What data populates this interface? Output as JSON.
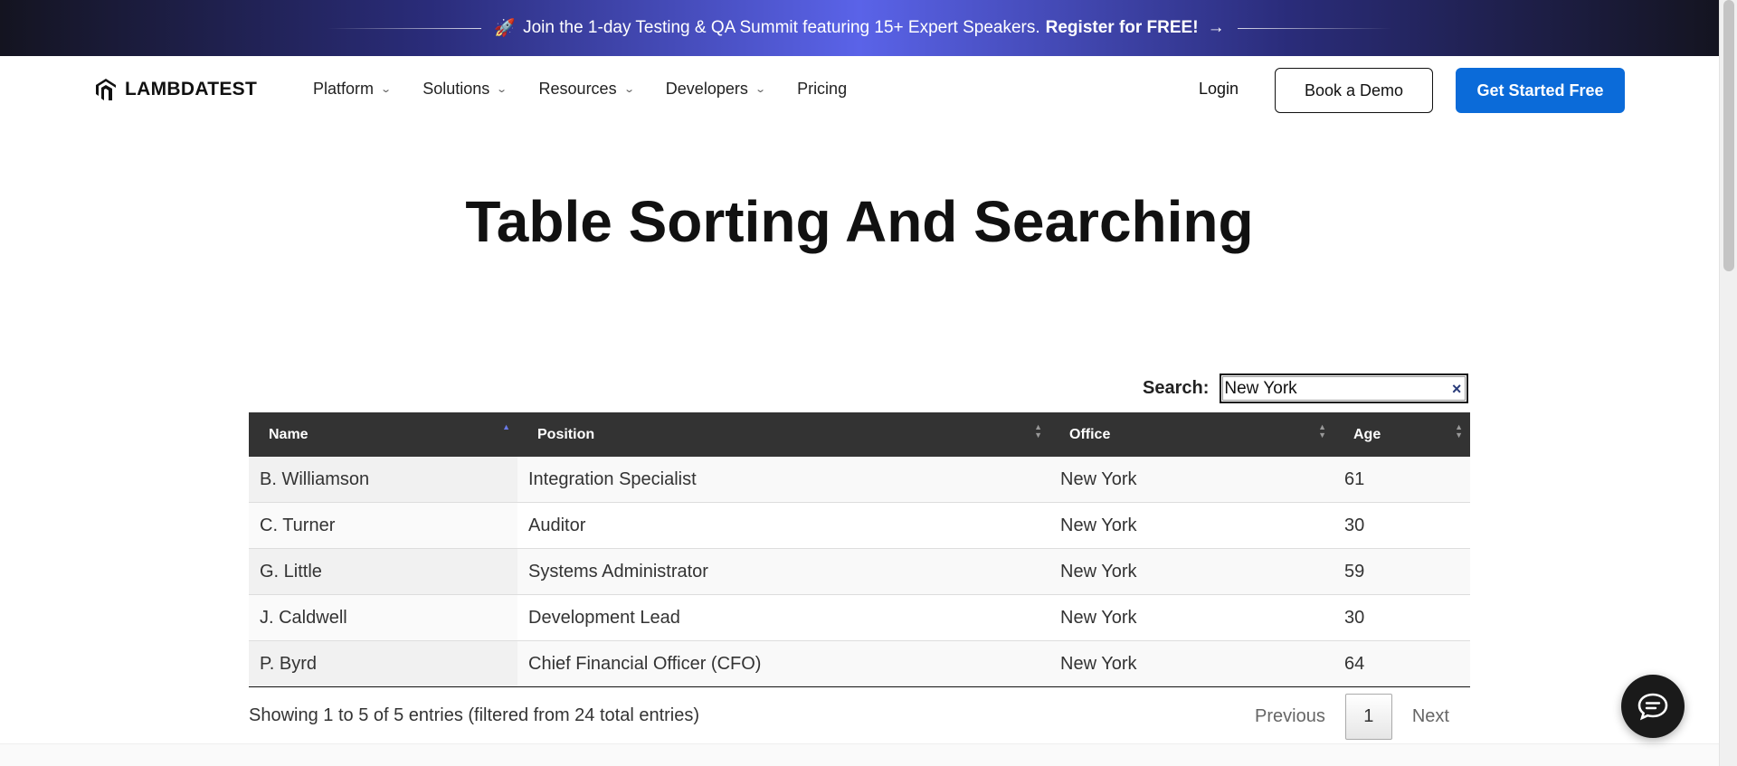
{
  "banner": {
    "text": "Join the 1-day Testing & QA Summit featuring 15+ Expert Speakers.",
    "cta": "Register for FREE!",
    "rocket": "🚀",
    "arrow": "→"
  },
  "nav": {
    "logo": "LAMBDATEST",
    "menu": [
      {
        "label": "Platform",
        "has_dropdown": true
      },
      {
        "label": "Solutions",
        "has_dropdown": true
      },
      {
        "label": "Resources",
        "has_dropdown": true
      },
      {
        "label": "Developers",
        "has_dropdown": true
      },
      {
        "label": "Pricing",
        "has_dropdown": false
      }
    ],
    "login": "Login",
    "book_demo": "Book a Demo",
    "get_started": "Get Started Free"
  },
  "page_title": "Table Sorting And Searching",
  "search": {
    "label": "Search:",
    "value": "New York",
    "clear_icon": "×"
  },
  "table": {
    "columns": [
      "Name",
      "Position",
      "Office",
      "Age"
    ],
    "sorted_column": "Name",
    "sort_direction": "asc",
    "rows": [
      {
        "name": "B. Williamson",
        "position": "Integration Specialist",
        "office": "New York",
        "age": "61"
      },
      {
        "name": "C. Turner",
        "position": "Auditor",
        "office": "New York",
        "age": "30"
      },
      {
        "name": "G. Little",
        "position": "Systems Administrator",
        "office": "New York",
        "age": "59"
      },
      {
        "name": "J. Caldwell",
        "position": "Development Lead",
        "office": "New York",
        "age": "30"
      },
      {
        "name": "P. Byrd",
        "position": "Chief Financial Officer (CFO)",
        "office": "New York",
        "age": "64"
      }
    ]
  },
  "info": "Showing 1 to 5 of 5 entries (filtered from 24 total entries)",
  "pagination": {
    "previous": "Previous",
    "current_page": "1",
    "next": "Next"
  },
  "colors": {
    "primary_button": "#0b6bd9",
    "table_header": "#333333",
    "sort_active": "#6a7ae8"
  }
}
